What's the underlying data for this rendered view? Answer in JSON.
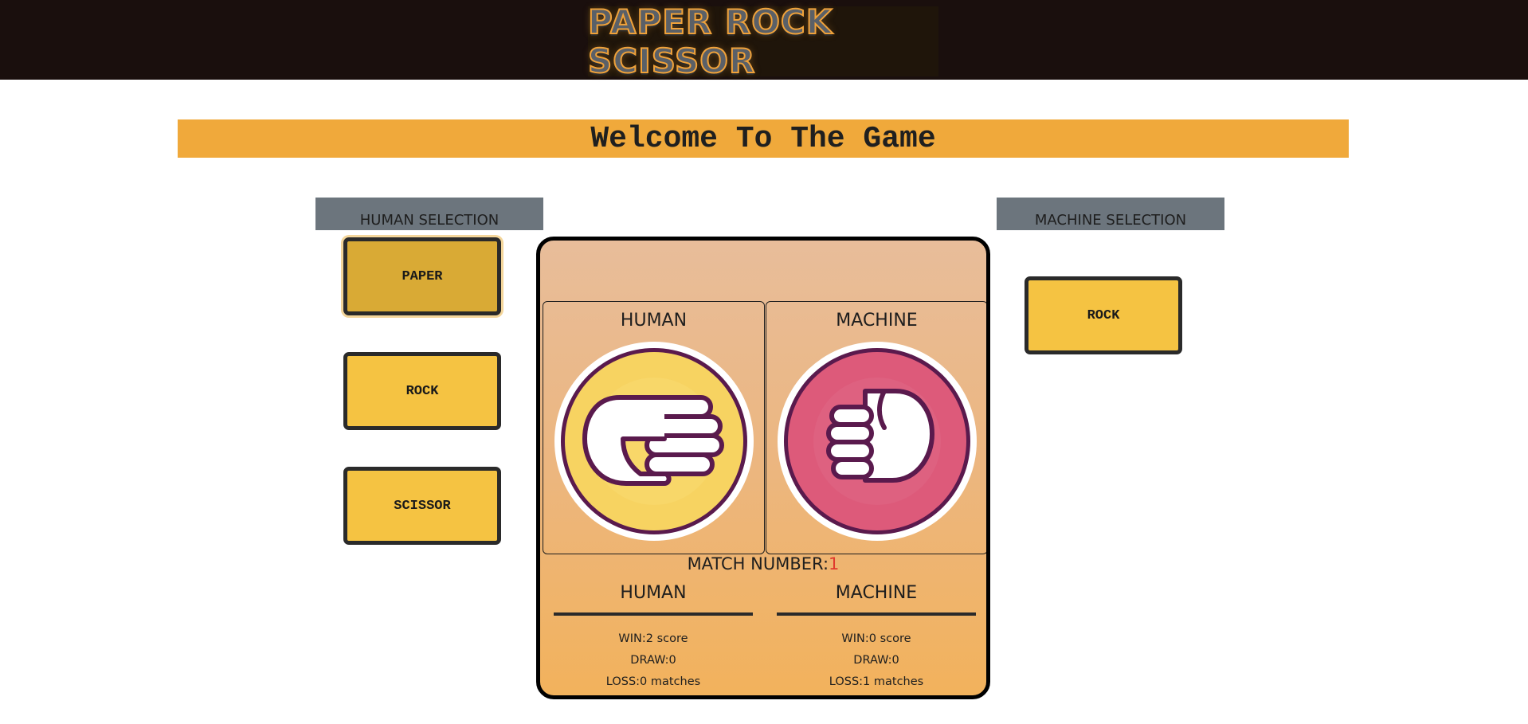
{
  "header": {
    "logo_text": "PAPER ROCK SCISSOR"
  },
  "banner": {
    "welcome": "Welcome To The Game"
  },
  "human_selection": {
    "title": "HUMAN SELECTION",
    "options": [
      "PAPER",
      "ROCK",
      "SCISSOR"
    ],
    "selected": "PAPER"
  },
  "machine_selection": {
    "title": "MACHINE SELECTION",
    "choice": "ROCK"
  },
  "board": {
    "human_label": "HUMAN",
    "machine_label": "MACHINE",
    "human_hand": "paper-hand-icon",
    "machine_hand": "rock-hand-icon",
    "match_label": "MATCH NUMBER:",
    "match_number": "1",
    "colors": {
      "human_circle": "#f7d361",
      "machine_circle": "#dd5a7a",
      "outline": "#5a1a4d"
    }
  },
  "scores": {
    "human": {
      "title": "HUMAN",
      "win": "WIN:2 score",
      "draw": "DRAW:0",
      "loss": "LOSS:0 matches"
    },
    "machine": {
      "title": "MACHINE",
      "win": "WIN:0 score",
      "draw": "DRAW:0",
      "loss": "LOSS:1 matches"
    }
  }
}
